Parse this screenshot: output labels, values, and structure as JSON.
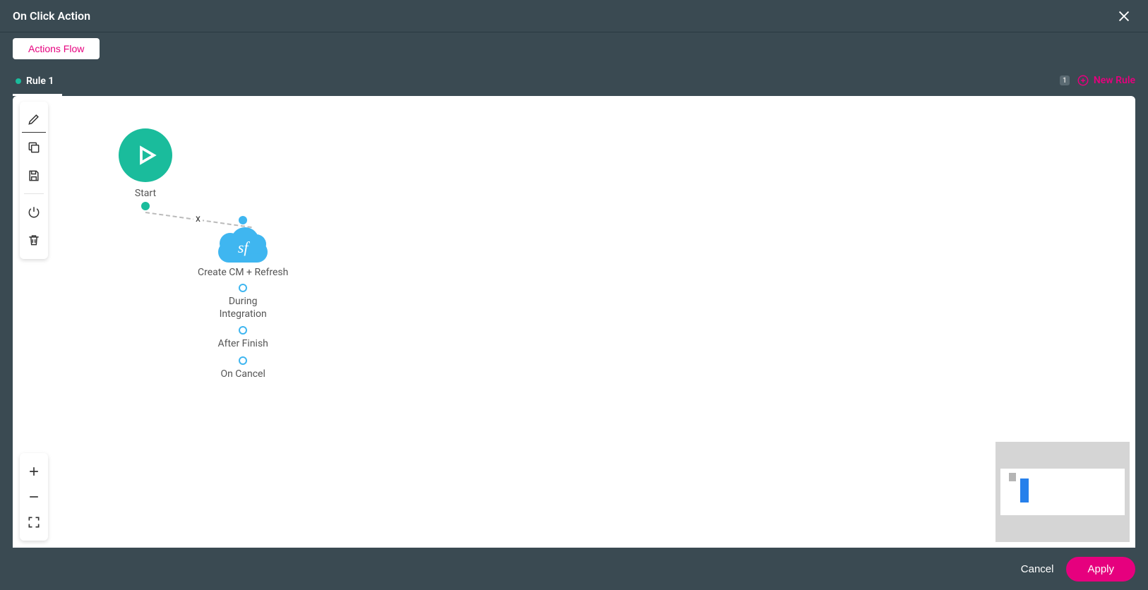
{
  "header": {
    "title": "On Click Action"
  },
  "toolbar": {
    "actions_flow_label": "Actions Flow"
  },
  "tabs": {
    "items": [
      {
        "label": "Rule 1",
        "active": true
      }
    ],
    "badge": "1",
    "new_rule_label": "New Rule"
  },
  "flow": {
    "start": {
      "label": "Start"
    },
    "sf_node": {
      "icon_text": "sf",
      "label": "Create CM + Refresh",
      "subs": [
        {
          "label": "During\nIntegration"
        },
        {
          "label": "After Finish"
        },
        {
          "label": "On Cancel"
        }
      ]
    },
    "connector_marker": "x"
  },
  "footer": {
    "cancel_label": "Cancel",
    "apply_label": "Apply"
  }
}
